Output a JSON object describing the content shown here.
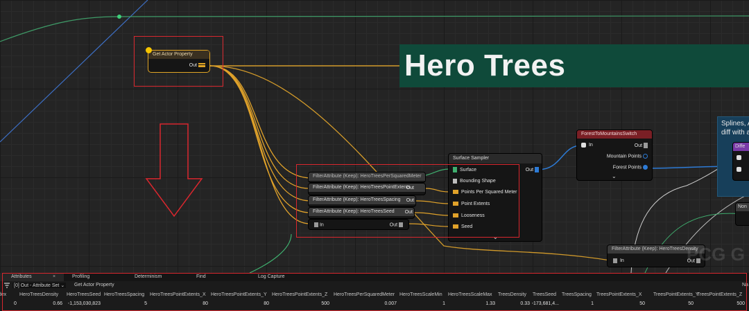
{
  "nodes": {
    "get_actor_property": {
      "title": "Get Actor Property",
      "out": "Out"
    },
    "surface_sampler": {
      "title": "Surface Sampler",
      "out": "Out",
      "pins": [
        "Surface",
        "Bounding Shape",
        "Points Per Squared Meter",
        "Point Extents",
        "Looseness",
        "Seed"
      ]
    },
    "filter_nodes": [
      "FilterAttribute (Keep): HeroTreesPerSquaredMeter",
      "FilterAttribute (Keep): HeroTreesPointExtents",
      "FilterAttribute (Keep): HeroTreesSpacing",
      "FilterAttribute (Keep): HeroTreesSeed"
    ],
    "filter_out": "Out",
    "filter_in": "In",
    "forest_switch": {
      "title": "ForestToMountainsSwitch",
      "in": "In",
      "out": "Out",
      "pins": [
        "Mountain Points",
        "Forest Points"
      ]
    },
    "filter_density": {
      "title": "FilterAttribute (Keep): HeroTreesDensity",
      "in": "In",
      "out": "Out"
    },
    "diff_header": "Diffe",
    "none_node": "Non"
  },
  "comments": {
    "hero_trees": "Hero Trees",
    "splines_line1": "Splines, As",
    "splines_line2": "diff with a",
    "watermark": "PCG G"
  },
  "panel": {
    "tabs": [
      "Attributes",
      "Profiling",
      "Determinism",
      "Find",
      "Log Capture"
    ],
    "close_glyph": "×",
    "toolbar": {
      "selector": "[0] Out - Attribute Set",
      "node_name": "Get Actor Property",
      "right_cut": "Na"
    },
    "headers": [
      "Index",
      "HeroTreesDensity",
      "HeroTreesSeed",
      "HeroTreesSpacing",
      "HeroTreesPointExtents_X",
      "HeroTreesPointExtents_Y",
      "HeroTreesPointExtents_Z",
      "HeroTreesPerSquaredMeter",
      "HeroTreesScaleMin",
      "HeroTreesScaleMax",
      "TreesDensity",
      "TreesSeed",
      "TreesSpacing",
      "TreesPointExtents_X",
      "TreesPointExtents_Y",
      "TreesPointExtents_Z"
    ],
    "row": [
      "0",
      "0.66",
      "-1,153,030,823",
      "5",
      "80",
      "80",
      "500",
      "0.007",
      "1",
      "1.33",
      "0.33",
      "-173,681,4...",
      "1",
      "50",
      "50",
      "500"
    ]
  },
  "colors": {
    "accent_red": "#d9272e",
    "comment_green": "#0f4a3a",
    "wire_orange": "#e0a22a",
    "wire_blue": "#2d7bd6",
    "wire_green": "#3fae6e"
  }
}
